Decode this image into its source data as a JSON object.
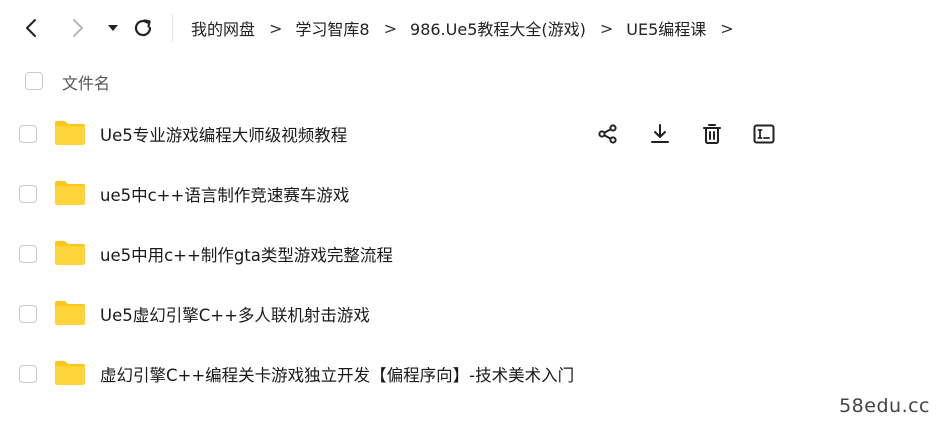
{
  "breadcrumb": [
    "我的网盘",
    "学习智库8",
    "986.Ue5教程大全(游戏)",
    "UE5编程课"
  ],
  "breadcrumb_separator": ">",
  "file_list": {
    "header_label": "文件名",
    "items": [
      {
        "name": "Ue5专业游戏编程大师级视频教程"
      },
      {
        "name": "ue5中c++语言制作竞速赛车游戏"
      },
      {
        "name": "ue5中用c++制作gta类型游戏完整流程"
      },
      {
        "name": "Ue5虚幻引擎C++多人联机射击游戏"
      },
      {
        "name": "虚幻引擎C++编程关卡游戏独立开发【偏程序向】-技术美术入门"
      }
    ]
  },
  "row_actions": [
    "share-icon",
    "download-icon",
    "delete-icon",
    "rename-icon"
  ],
  "watermark": "58edu.cc",
  "colors": {
    "folder": "#FFD43B",
    "folder_tab": "#FFC61A",
    "border": "#c9c9c9"
  }
}
